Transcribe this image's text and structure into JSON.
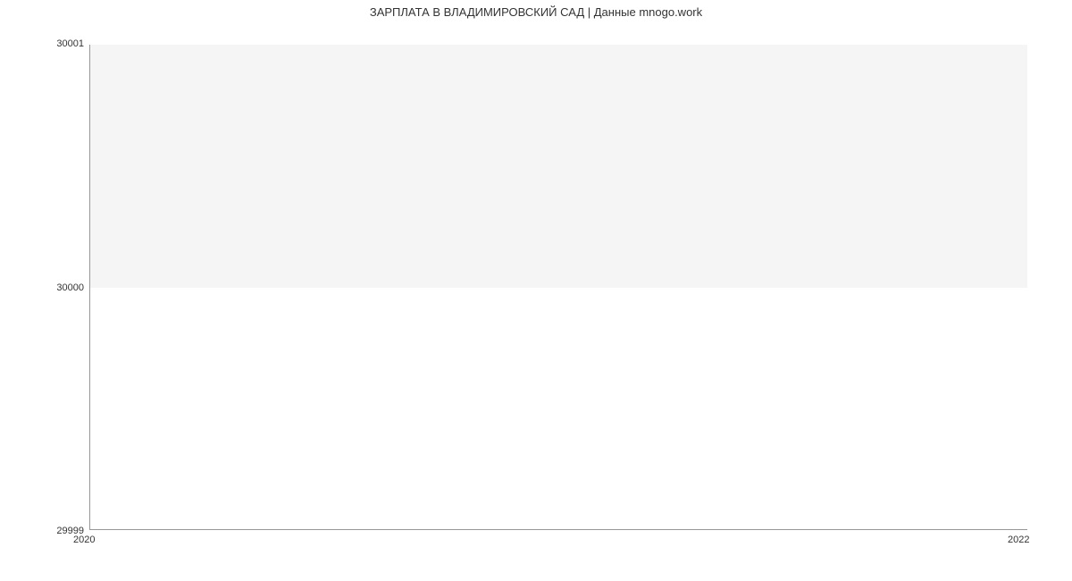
{
  "chart_data": {
    "type": "line",
    "title": "ЗАРПЛАТА В ВЛАДИМИРОВСКИЙ САД | Данные mnogo.work",
    "xlabel": "",
    "ylabel": "",
    "x": [
      2020,
      2022
    ],
    "values": [
      30000,
      30000
    ],
    "ylim": [
      29999,
      30001
    ],
    "xlim": [
      2020,
      2022
    ],
    "x_ticks": [
      "2020",
      "2022"
    ],
    "y_ticks": [
      "29999",
      "30000",
      "30001"
    ],
    "line_color": "#3a7fd5",
    "plot_bg": "#f5f5f5"
  }
}
